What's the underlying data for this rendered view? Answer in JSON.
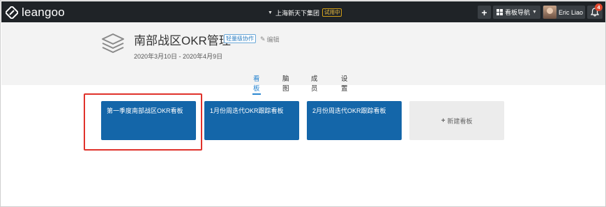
{
  "app": {
    "brand_name": "leangoo"
  },
  "topbar": {
    "org_name": "上海新天下集团",
    "trial_label": "试用中",
    "add_label": "+",
    "board_nav_label": "看板导航",
    "user_name": "Eric Liao",
    "notification_count": "4"
  },
  "project": {
    "title": "南部战区OKR管理",
    "badge": "轻量级协作",
    "edit_label": "编辑",
    "date_range": "2020年3月10日 - 2020年4月9日"
  },
  "tabs": [
    {
      "label": "看板",
      "active": true
    },
    {
      "label": "脑图",
      "active": false
    },
    {
      "label": "成员",
      "active": false
    },
    {
      "label": "设置",
      "active": false
    }
  ],
  "boards": [
    {
      "title": "第一季度南部战区OKR看板"
    },
    {
      "title": "1月份周迭代OKR跟踪看板"
    },
    {
      "title": "2月份周迭代OKR跟踪看板"
    }
  ],
  "new_board": {
    "label": "新建看板"
  },
  "colors": {
    "topbar": "#1f2327",
    "board": "#1466a9",
    "accent": "#2a86d0",
    "highlight": "#e0312a"
  }
}
